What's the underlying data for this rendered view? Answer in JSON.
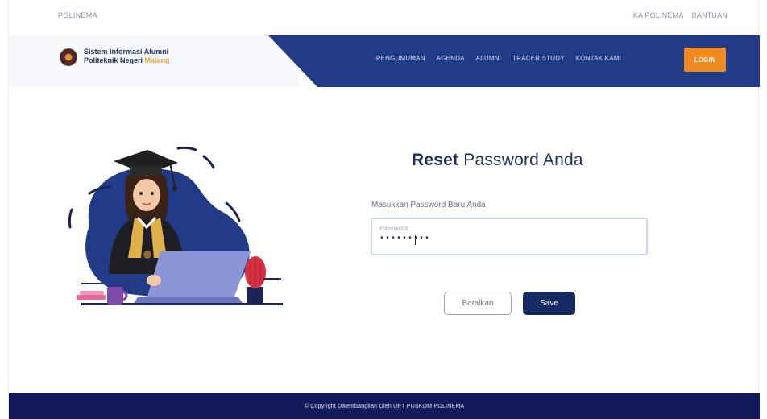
{
  "topbar": {
    "brand": "POLINEMA",
    "links": [
      "IKA POLINEMA",
      "BANTUAN"
    ]
  },
  "header": {
    "brand_line1": "Sistem Informasi Alumni",
    "brand_line2_prefix": "Politeknik Negeri ",
    "brand_line2_accent": "Malang",
    "nav": [
      "PENGUMUMAN",
      "AGENDA",
      "ALUMNI",
      "TRACER STUDY",
      "KONTAK KAMI"
    ],
    "login_label": "LOGIN"
  },
  "form": {
    "title_bold": "Reset",
    "title_light": " Password Anda",
    "label": "Masukkan Password Baru Anda",
    "password_placeholder": "Password",
    "password_value": "•••••••••",
    "cancel_label": "Batalkan",
    "save_label": "Save"
  },
  "footer": {
    "copyright": "© Copyright Dikembangkan Oleh UPT PUSKOM POLINEMA"
  },
  "colors": {
    "navy": "#213b89",
    "dark_navy": "#152a63",
    "orange": "#f08a1f",
    "footer": "#13195a"
  }
}
